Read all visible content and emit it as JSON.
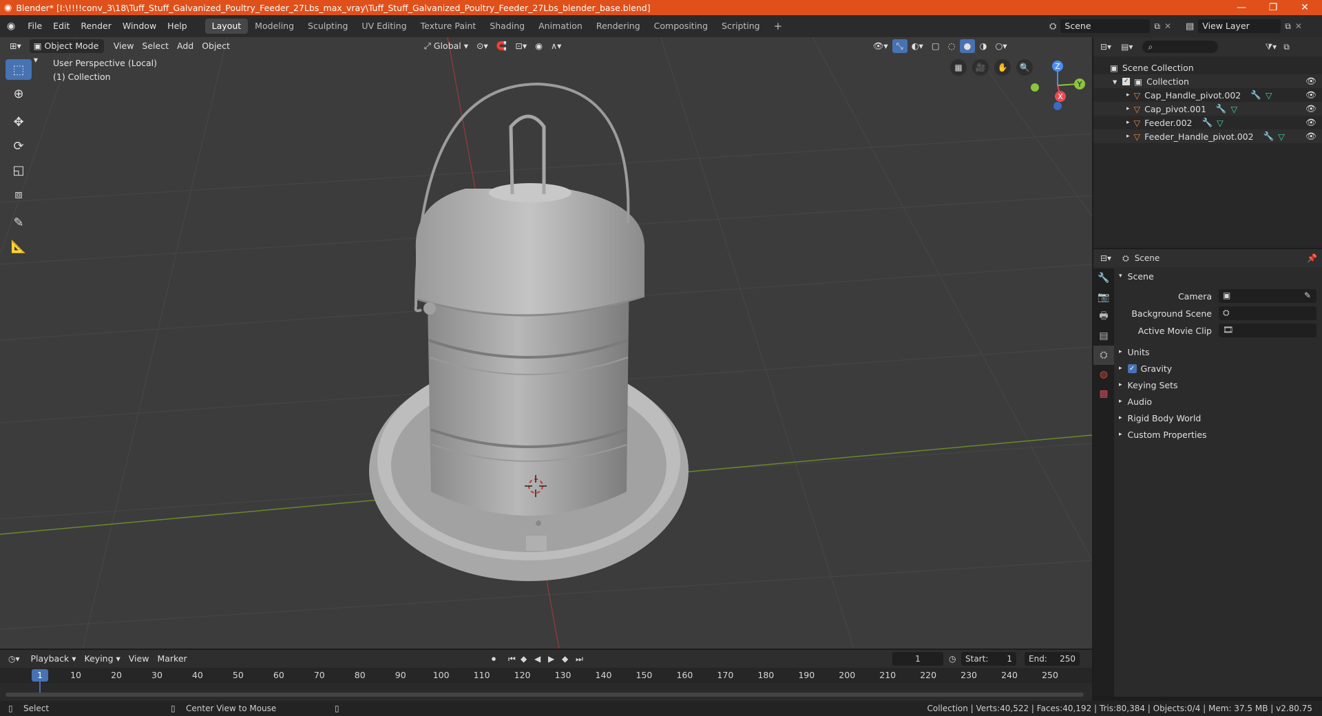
{
  "window": {
    "title": "Blender* [I:\\!!!!conv_3\\18\\Tuff_Stuff_Galvanized_Poultry_Feeder_27Lbs_max_vray\\Tuff_Stuff_Galvanized_Poultry_Feeder_27Lbs_blender_base.blend]",
    "minimize": "—",
    "maximize": "❐",
    "close": "✕"
  },
  "menu": [
    "File",
    "Edit",
    "Render",
    "Window",
    "Help"
  ],
  "workspaces": [
    "Layout",
    "Modeling",
    "Sculpting",
    "UV Editing",
    "Texture Paint",
    "Shading",
    "Animation",
    "Rendering",
    "Compositing",
    "Scripting"
  ],
  "workspace_add": "+",
  "scene_field": "Scene",
  "view_layer_field": "View Layer",
  "viewport": {
    "mode": "Object Mode",
    "menus": [
      "View",
      "Select",
      "Add",
      "Object"
    ],
    "orientation": "Global",
    "info_line1": "User Perspective (Local)",
    "info_line2": "(1) Collection",
    "gizmo": {
      "z": "Z",
      "y": "Y",
      "x": "X"
    }
  },
  "outliner": {
    "root": "Scene Collection",
    "collection": "Collection",
    "items": [
      "Cap_Handle_pivot.002",
      "Cap_pivot.001",
      "Feeder.002",
      "Feeder_Handle_pivot.002"
    ]
  },
  "properties": {
    "header": "Scene",
    "panel": "Scene",
    "fields": [
      {
        "label": "Camera"
      },
      {
        "label": "Background Scene"
      },
      {
        "label": "Active Movie Clip"
      }
    ],
    "sections": [
      "Units",
      "Gravity",
      "Keying Sets",
      "Audio",
      "Rigid Body World",
      "Custom Properties"
    ],
    "gravity_checked": true
  },
  "timeline": {
    "menus": [
      "Playback",
      "Keying",
      "View",
      "Marker"
    ],
    "current_frame": "1",
    "start_label": "Start:",
    "start": "1",
    "end_label": "End:",
    "end": "250",
    "ticks": [
      "1",
      "10",
      "20",
      "30",
      "40",
      "50",
      "60",
      "70",
      "80",
      "90",
      "100",
      "110",
      "120",
      "130",
      "140",
      "150",
      "160",
      "170",
      "180",
      "190",
      "200",
      "210",
      "220",
      "230",
      "240",
      "250"
    ]
  },
  "status": {
    "left1": "Select",
    "left2": "Center View to Mouse",
    "right": "Collection | Verts:40,522 | Faces:40,192 | Tris:80,384 | Objects:0/4 | Mem: 37.5 MB | v2.80.75"
  },
  "colors": {
    "titlebar": "#e0501a",
    "accent": "#4772b3",
    "object_icon": "#e8893a",
    "modifier_icon": "#6ea0e6",
    "mesh_icon": "#44d4a4",
    "x_axis": "#e84b55",
    "y_axis": "#8cc43c",
    "z_axis": "#4a8ef0"
  }
}
